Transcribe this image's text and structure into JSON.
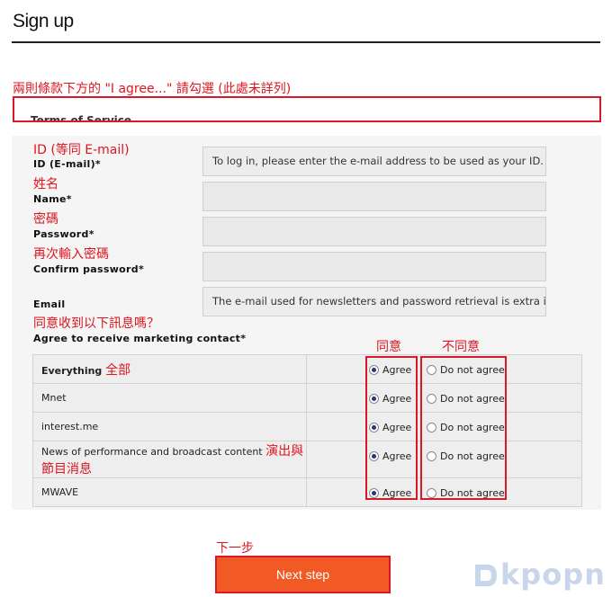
{
  "page": {
    "title": "Sign up"
  },
  "annotations": {
    "terms": "兩則條款下方的 \"I agree...\" 請勾選 (此處未詳列)",
    "id": "ID (等同 E-mail)",
    "name": "姓名",
    "password": "密碼",
    "confirm": "再次輸入密碼",
    "marketing": "同意收到以下訊息嗎？",
    "agree_col": "同意",
    "disagree_col": "不同意",
    "everything": "全部",
    "news": "演出與節目消息",
    "next": "下一步"
  },
  "terms": {
    "heading": "Terms of Service"
  },
  "form": {
    "id_label": "ID (E-mail)*",
    "id_hint": "To log in, please enter the e-mail address to be used as your ID.",
    "name_label": "Name*",
    "password_label": "Password*",
    "confirm_label": "Confirm password*",
    "email_label": "Email",
    "email_hint": "The e-mail used for newsletters and password retrieval is extra info",
    "marketing_label": "Agree to receive marketing contact*"
  },
  "consent": {
    "agree_label": "Agree",
    "disagree_label": "Do not agree",
    "rows": [
      {
        "label": "Everything",
        "selected": "agree"
      },
      {
        "label": "Mnet",
        "selected": "agree"
      },
      {
        "label": "interest.me",
        "selected": "agree"
      },
      {
        "label": "News of performance and broadcast content",
        "selected": "agree"
      },
      {
        "label": "MWAVE",
        "selected": "agree"
      }
    ]
  },
  "actions": {
    "next_label": "Next step"
  },
  "watermark": {
    "text": "kpopn"
  },
  "colors": {
    "accent": "#f15a24",
    "annotation": "#e0141e",
    "radio_selected": "#1e3a78"
  }
}
